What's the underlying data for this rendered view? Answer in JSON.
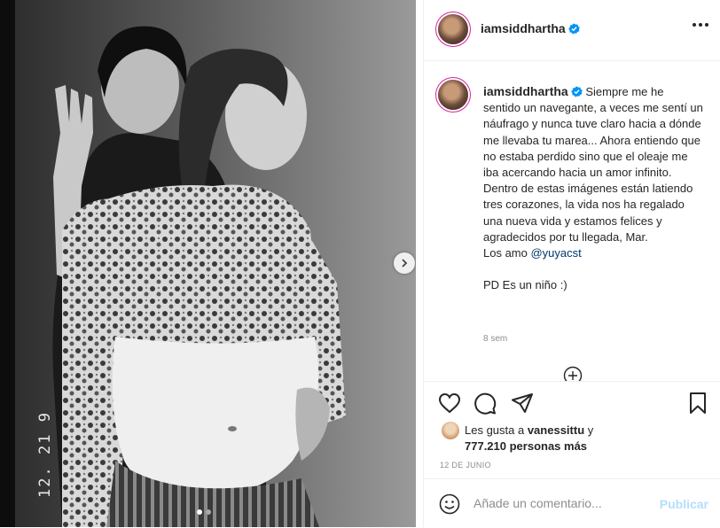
{
  "post": {
    "username": "iamsiddhartha",
    "verified": true,
    "photo": {
      "date_stamp": "12. 21 9",
      "carousel_total": 2,
      "carousel_active": 1
    },
    "caption": {
      "text": "Siempre me he sentido un navegante, a veces me sentí un náufrago y nunca tuve claro hacia a dónde me llevaba tu marea... Ahora entiendo que no estaba perdido sino que el oleaje me iba acercando hacia un amor infinito.\nDentro de estas imágenes están latiendo tres corazones, la vida nos ha regalado una nueva vida y estamos felices y agradecidos por tu llegada, Mar.\nLos amo ",
      "mention": "@yuyacst",
      "ps": "\n\nPD Es un niño :)",
      "time_ago": "8 sem"
    },
    "likes": {
      "prefix": "Les gusta a ",
      "first_user": "vanessittu",
      "suffix": " y",
      "others": "777.210 personas más"
    },
    "post_date": "12 DE JUNIO",
    "comment_box": {
      "placeholder": "Añade un comentario...",
      "publish_label": "Publicar"
    },
    "icons": {
      "verified": "verified-badge-icon",
      "more": "more-options-icon",
      "next": "chevron-right-icon",
      "like": "heart-icon",
      "comment": "comment-bubble-icon",
      "share": "paper-plane-icon",
      "save": "bookmark-icon",
      "emoji": "emoji-smiley-icon",
      "load_more": "plus-circle-icon"
    },
    "colors": {
      "verified_blue": "#0095f6",
      "link": "#00376b",
      "publish_disabled": "#b2dffc",
      "story_ring": "#d6249f"
    }
  }
}
